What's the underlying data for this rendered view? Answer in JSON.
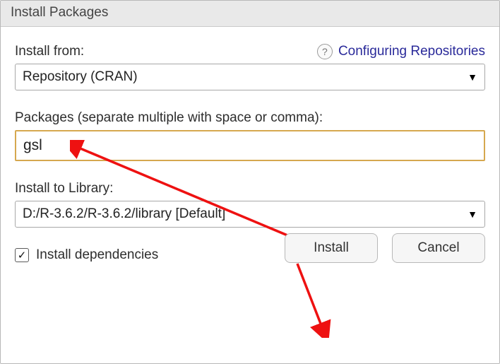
{
  "title": "Install Packages",
  "install_from": {
    "label": "Install from:",
    "value": "Repository (CRAN)"
  },
  "help": {
    "icon_text": "?",
    "link_text": "Configuring Repositories"
  },
  "packages": {
    "label": "Packages (separate multiple with space or comma):",
    "value": "gsl"
  },
  "install_to": {
    "label": "Install to Library:",
    "value": "D:/R-3.6.2/R-3.6.2/library [Default]"
  },
  "dependencies": {
    "label": "Install dependencies",
    "checked_glyph": "✓"
  },
  "buttons": {
    "install": "Install",
    "cancel": "Cancel"
  }
}
